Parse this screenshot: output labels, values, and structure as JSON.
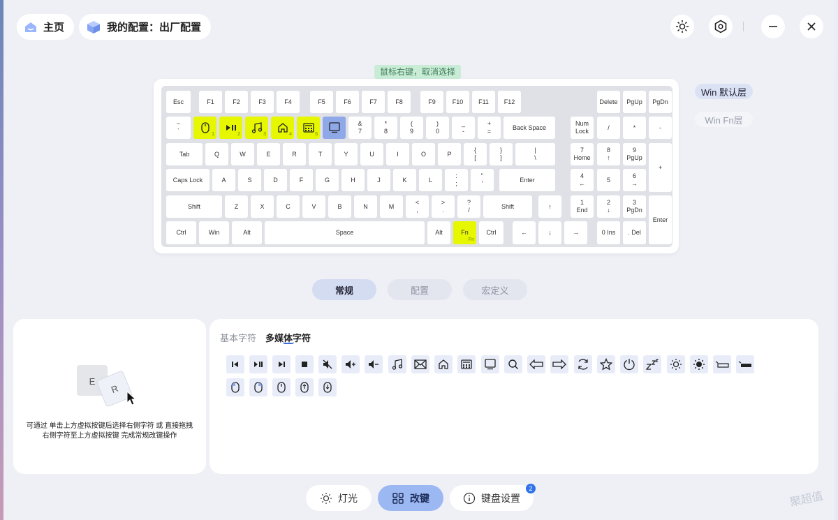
{
  "topbar": {
    "home_label": "主页",
    "config_label": "我的配置：出厂配置"
  },
  "hint": "鼠标右键，取消选择",
  "layers": {
    "default": "Win 默认层",
    "fn": "Win Fn层"
  },
  "keys": {
    "esc": "Esc",
    "f1": "F1",
    "f2": "F2",
    "f3": "F3",
    "f4": "F4",
    "f5": "F5",
    "f6": "F6",
    "f7": "F7",
    "f8": "F8",
    "f9": "F9",
    "f10": "F10",
    "f11": "F11",
    "f12": "F12",
    "delete": "Delete",
    "pgup": "PgUp",
    "pgdn": "PgDn",
    "tilde_top": "~",
    "tilde_bot": "`",
    "k1": "1",
    "k2": "2",
    "k3": "3",
    "k4": "4",
    "k5": "5",
    "k7_top": "&",
    "k7_bot": "7",
    "k8_top": "*",
    "k8_bot": "8",
    "k9_top": "(",
    "k9_bot": "9",
    "k0_top": ")",
    "k0_bot": "0",
    "minus_top": "_",
    "minus_bot": "-",
    "plus_top": "+",
    "plus_bot": "=",
    "backspace": "Back Space",
    "numlock_top": "Num",
    "numlock_bot": "Lock",
    "np_slash": "/",
    "np_star": "*",
    "np_minus": "-",
    "tab": "Tab",
    "q": "Q",
    "w": "W",
    "e": "E",
    "r": "R",
    "t": "T",
    "y": "Y",
    "u": "U",
    "i": "I",
    "o": "O",
    "p": "P",
    "lbr_top": "{",
    "lbr_bot": "[",
    "rbr_top": "}",
    "rbr_bot": "]",
    "bs_top": "|",
    "bs_bot": "\\",
    "np7_top": "7",
    "np7_bot": "Home",
    "np8_top": "8",
    "np8_bot": "↑",
    "np9_top": "9",
    "np9_bot": "PgUp",
    "np_plus": "+",
    "caps": "Caps Lock",
    "a": "A",
    "s": "S",
    "d": "D",
    "f": "F",
    "g": "G",
    "h": "H",
    "j": "J",
    "k": "K",
    "l": "L",
    "semi_top": ":",
    "semi_bot": ";",
    "quote_top": "\"",
    "quote_bot": "'",
    "enter": "Enter",
    "np4_top": "4",
    "np4_bot": "←",
    "np5": "5",
    "np6_top": "6",
    "np6_bot": "→",
    "lshift": "Shift",
    "z": "Z",
    "x": "X",
    "c": "C",
    "v": "V",
    "b": "B",
    "n": "N",
    "m": "M",
    "comma_top": "<",
    "comma_bot": ",",
    "dot_top": ">",
    "dot_bot": ".",
    "slash_top": "?",
    "slash_bot": "/",
    "rshift": "Shift",
    "up": "↑",
    "np1_top": "1",
    "np1_bot": "End",
    "np2_top": "2",
    "np2_bot": "↓",
    "np3_top": "3",
    "np3_bot": "PgDn",
    "np_enter": "Enter",
    "lctrl": "Ctrl",
    "win": "Win",
    "lalt": "Alt",
    "space": "Space",
    "ralt": "Alt",
    "fn": "Fn",
    "fn_sub": "Fn",
    "rctrl": "Ctrl",
    "left": "←",
    "down": "↓",
    "right": "→",
    "np0": "0 Ins",
    "npdel": ". Del"
  },
  "mode_tabs": {
    "normal": "常规",
    "config": "配置",
    "macro": "宏定义"
  },
  "help": {
    "key_e": "E",
    "key_r": "R",
    "line1": "可通过  单击上方虚拟按键后选择右侧字符 或 直接拖拽",
    "line2": "右侧字符至上方虚拟按键 完成常规改键操作"
  },
  "char_tabs": {
    "basic": "基本字符",
    "media": "多媒体字符"
  },
  "media_icons": [
    "prev-track-icon",
    "play-pause-icon",
    "next-track-icon",
    "stop-icon",
    "mute-icon",
    "volume-up-icon",
    "volume-down-icon",
    "music-icon",
    "mail-icon",
    "home-icon",
    "calculator-icon",
    "my-computer-icon",
    "search-icon",
    "back-icon",
    "forward-icon",
    "refresh-icon",
    "favorites-icon",
    "power-icon",
    "sleep-icon",
    "brightness-down-icon",
    "brightness-up-icon",
    "backlight-down-icon",
    "backlight-up-icon",
    "mouse-left-icon",
    "mouse-right-icon",
    "mouse-middle-icon",
    "mouse-back-icon",
    "mouse-forward-icon"
  ],
  "bottom_nav": {
    "light": "灯光",
    "remap": "改键",
    "settings": "键盘设置",
    "settings_badge": "2"
  },
  "watermark": "聚超值",
  "colors": {
    "highlight": "#e6f700",
    "selected": "#8fa8e8",
    "accent": "#3d6ee0"
  }
}
